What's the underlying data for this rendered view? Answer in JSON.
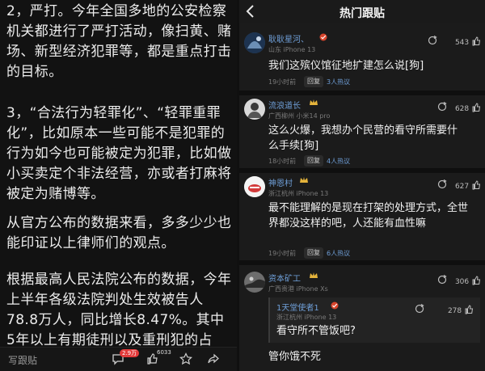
{
  "left": {
    "paragraphs": [
      "2，严打。今年全国多地的公安检察机关都进行了严打活动，像扫黄、赌场、新型经济犯罪等，都是重点打击的目标。",
      "3，“合法行为轻罪化”、“轻罪重罪化”，比如原本一些可能不是犯罪的行为如今也可能被定为犯罪，比如做小买卖定个非法经营，亦或者打麻将被定为赌博等。",
      "从官方公布的数据来看，多多少少也能印证以上律师们的观点。",
      "根据最高人民法院公布的数据，今年上半年各级法院判处生效被告人78.8万人，同比增长8.47%。其中5年以上有期徒刑以及重刑犯的占"
    ],
    "bottom_bar": {
      "follow_label": "写跟贴",
      "comment_count_badge": "2.9万",
      "like_count": "6033"
    }
  },
  "right": {
    "header_title": "热门跟贴",
    "comments": [
      {
        "username": "耿耿星河、",
        "location": "山东",
        "device": "iPhone 13",
        "likes": "543",
        "text": "我们这殡仪馆征地扩建怎么说[狗]",
        "time": "19小时前",
        "reply_label": "回复",
        "hot": "3人热议",
        "avatar_color": "#2c4a6a"
      },
      {
        "username": "流浪道长",
        "location": "广西柳州",
        "device": "小米14 pro",
        "likes": "628",
        "text": "这么火爆，我想办个民营的看守所需要什么手续[狗]",
        "time": "18小时前",
        "reply_label": "回复",
        "hot": "4人热议",
        "avatar_color": "#8a8a8a"
      },
      {
        "username": "神恩村",
        "location": "浙江杭州",
        "device": "iPhone 13",
        "likes": "627",
        "text": "最不能理解的是现在打架的处理方式，全世界都没这样的吧，人还能有血性嘛",
        "time": "19小时前",
        "reply_label": "回复",
        "hot": "6人热议",
        "avatar_color": "#f3f3f3"
      },
      {
        "username": "资本矿工",
        "location": "广西贵港",
        "device": "iPhone Xs",
        "likes": "306",
        "quote": {
          "username": "1天堂使者1",
          "location": "浙江杭州",
          "device": "iPhone 13",
          "likes": "278",
          "text": "看守所不管饭吧?"
        },
        "text": "管你饿不死",
        "avatar_color": "#3b3b3b"
      }
    ]
  },
  "colors": {
    "link_blue": "#6f9fd8",
    "badge_red": "#e23a3a",
    "background": "#101010"
  }
}
